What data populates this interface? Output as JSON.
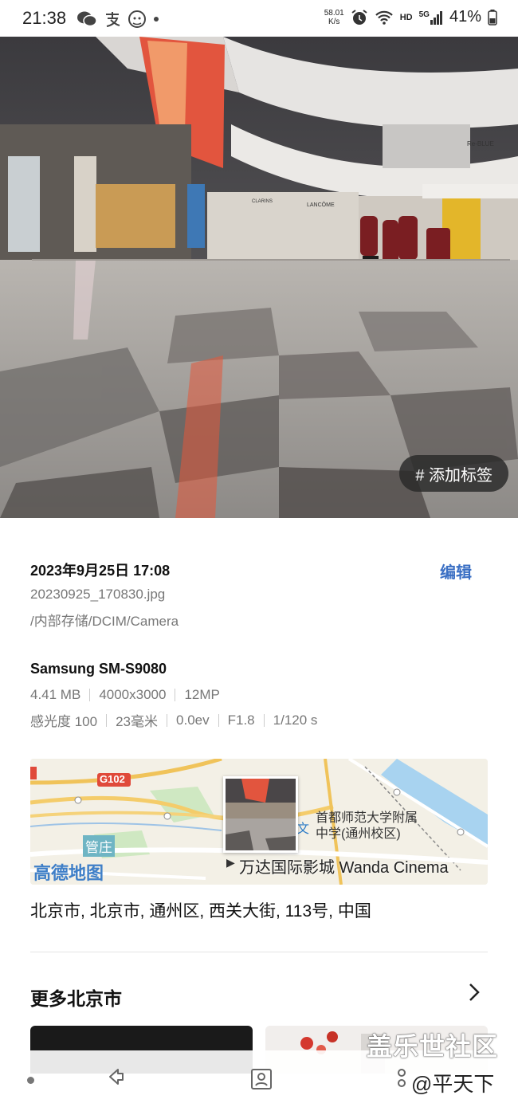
{
  "status_bar": {
    "time": "21:38",
    "net_speed_value": "58.01",
    "net_speed_unit": "K/s",
    "hd_label": "HD",
    "signal_label": "5G",
    "battery": "41%"
  },
  "photo": {
    "tag_button": "# 添加标签",
    "scene_signs": [
      "Re-BLUE",
      "LANCÔME",
      "CLARINS"
    ]
  },
  "details": {
    "datetime": "2023年9月25日 17:08",
    "edit_label": "编辑",
    "filename": "20230925_170830.jpg",
    "path": "/内部存储/DCIM/Camera",
    "device": "Samsung SM-S9080",
    "size": "4.41 MB",
    "resolution": "4000x3000",
    "megapixels": "12MP",
    "iso": "感光度 100",
    "focal_length": "23毫米",
    "exposure_comp": "0.0ev",
    "aperture": "F1.8",
    "shutter": "1/120 s"
  },
  "map": {
    "road_label": "G102",
    "poi_school": "首都师范大学附属\n中学(通州校区)",
    "poi_cinema": "万达国际影城 Wanda Cinema",
    "area_label": "管庄",
    "provider_logo": "高德地图"
  },
  "address": "北京市, 北京市, 通州区, 西关大街, 113号, 中国",
  "more_section": {
    "title": "更多北京市"
  },
  "watermark": {
    "line1": "盖乐世社区",
    "line2": "@平天下"
  },
  "colors": {
    "accent": "#3a6fc4",
    "secondary_text": "#777777"
  }
}
